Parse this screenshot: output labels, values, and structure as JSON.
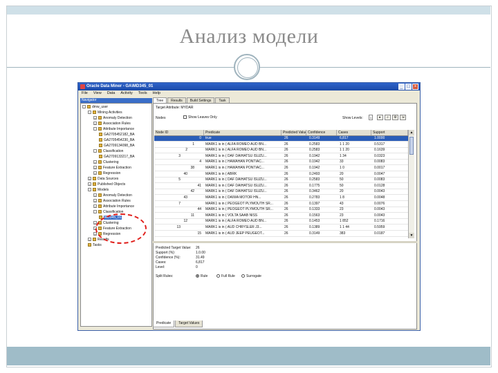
{
  "slide": {
    "title": "Анализ модели"
  },
  "window": {
    "title": "Oracle Data Miner - GA\\MD345_01",
    "min": "_",
    "max": "□",
    "close": "×"
  },
  "menu": [
    "File",
    "View",
    "Data",
    "Activity",
    "Tools",
    "Help"
  ],
  "navigator": {
    "header": "Navigator",
    "items": [
      {
        "label": "dmw_user",
        "indent": 0,
        "toggle": "-"
      },
      {
        "label": "Mining Activities",
        "indent": 1,
        "toggle": "-"
      },
      {
        "label": "Anomaly Detection",
        "indent": 2,
        "toggle": "+"
      },
      {
        "label": "Association Rules",
        "indent": 2,
        "toggle": "+"
      },
      {
        "label": "Attribute Importance",
        "indent": 2,
        "toggle": "-"
      },
      {
        "label": "GA2705452182_BA",
        "indent": 3,
        "toggle": ""
      },
      {
        "label": "GA2705454230_BA",
        "indent": 3,
        "toggle": ""
      },
      {
        "label": "GA2709134098_BA",
        "indent": 3,
        "toggle": ""
      },
      {
        "label": "Classification",
        "indent": 2,
        "toggle": "-"
      },
      {
        "label": "GA2709133217_BA",
        "indent": 3,
        "toggle": ""
      },
      {
        "label": "Clustering",
        "indent": 2,
        "toggle": "+"
      },
      {
        "label": "Feature Extraction",
        "indent": 2,
        "toggle": "+"
      },
      {
        "label": "Regression",
        "indent": 2,
        "toggle": "+"
      },
      {
        "label": "Data Sources",
        "indent": 1,
        "toggle": "+"
      },
      {
        "label": "Published Objects",
        "indent": 1,
        "toggle": "+"
      },
      {
        "label": "Models",
        "indent": 1,
        "toggle": "-"
      },
      {
        "label": "Anomaly Detection",
        "indent": 2,
        "toggle": "+"
      },
      {
        "label": "Association Rules",
        "indent": 2,
        "toggle": "+"
      },
      {
        "label": "Attribute Importance",
        "indent": 2,
        "toggle": "+"
      },
      {
        "label": "Classification",
        "indent": 2,
        "toggle": "-"
      },
      {
        "label": "MD345_01",
        "indent": 3,
        "toggle": "",
        "selected": true
      },
      {
        "label": "Clustering",
        "indent": 2,
        "toggle": "+"
      },
      {
        "label": "Feature Extraction",
        "indent": 2,
        "toggle": "+"
      },
      {
        "label": "Regression",
        "indent": 2,
        "toggle": "+"
      },
      {
        "label": "Results",
        "indent": 1,
        "toggle": "+"
      },
      {
        "label": "Tasks",
        "indent": 1,
        "toggle": ""
      }
    ]
  },
  "tabs": [
    "Tree",
    "Results",
    "Build Settings",
    "Task"
  ],
  "target": {
    "label": "Target Attribute:",
    "value": "MYDAR"
  },
  "nodes_label": "Nodes",
  "show_leaves": "Show Leaves Only",
  "show_levels_label": "Show Levels:",
  "show_levels_value": "1",
  "grid": {
    "columns": [
      "Node ID",
      "Predicate",
      "Predicted Value",
      "Confidence",
      "Cases",
      "Support"
    ],
    "rows": [
      [
        "0",
        "true",
        "26",
        "0.3149",
        "6,817",
        "1.0000"
      ],
      [
        "1",
        "MARK1 is in ( ALFA ROMEO AUD BN...",
        "26",
        "0.2583",
        "1 1 20",
        "0.5317"
      ],
      [
        "2",
        "MARK1 is in ( ALFA ROMEO AUD BN...",
        "26",
        "0.2583",
        "1 1 20",
        "0.1639"
      ],
      [
        "3",
        "MARK1 is in ( DAF DAIHATSU ISUZU...",
        "26",
        "0.1942",
        "1 34",
        "0.0323"
      ],
      [
        "4",
        "MARK1 is in ( HAWAHAN PONTIAC...",
        "26",
        "0.1942",
        "33",
        "0.0083"
      ],
      [
        "38",
        "MARK1 is in ( HAWAHAN PONTIAC...",
        "26",
        "0.1942",
        "1 0",
        "0.0017"
      ],
      [
        "40",
        "MARK1 is in ( ABRK",
        "26",
        "0.2493",
        "20",
        "0.0047"
      ],
      [
        "5",
        "MARK1 is in ( DAF DAIHATSU ISUZU...",
        "26",
        "0.2583",
        "50",
        "0.0083"
      ],
      [
        "41",
        "MARK1 is in ( DAF DAIHATSU ISUZU...",
        "26",
        "0.1775",
        "50",
        "0.0128"
      ],
      [
        "42",
        "MARK1 is in ( DAF DAIHATSU ISUZU...",
        "26",
        "0.3462",
        "20",
        "0.0043"
      ],
      [
        "43",
        "MARK1 is in ( DAIWA MOTOR HN...",
        "26",
        "0.2783",
        "1 8",
        "0.0048"
      ],
      [
        "7",
        "MARK1 is in ( PEOGEOT PLYMOUTH SR...",
        "26",
        "0.1397",
        "43",
        "0.0076"
      ],
      [
        "44",
        "MARK1 is in ( PEOGEOT PLYMOUTH SR...",
        "26",
        "0.1333",
        "23",
        "0.0043"
      ],
      [
        "11",
        "MARK1 is in ( VOLTA SAAB NISS",
        "26",
        "0.1563",
        "23",
        "0.0043"
      ],
      [
        "12",
        "MARK1 is in ( ALFA ROMEO AUD BN...",
        "26",
        "0.1453",
        "1 852",
        "0.1716"
      ],
      [
        "13",
        "MARK1 is in ( AUD CHRYSLER J3...",
        "26",
        "0.1389",
        "1 1 44",
        "0.5959"
      ],
      [
        "15",
        "MARK1 is in ( AUD JEEP PEUGEOT...",
        "26",
        "0.3149",
        "383",
        "0.0187"
      ]
    ]
  },
  "detail": {
    "rows": [
      {
        "label": "Predicted Target Value:",
        "value": "26"
      },
      {
        "label": "Support (%):",
        "value": "1.0.00"
      },
      {
        "label": "Confidence (%):",
        "value": "31.49"
      },
      {
        "label": "Cases:",
        "value": "6,817"
      },
      {
        "label": "Level:",
        "value": "0"
      }
    ],
    "split_label": "Split Rules:",
    "split_options": [
      {
        "label": "Rule",
        "selected": true
      },
      {
        "label": "Full Rule",
        "selected": false
      },
      {
        "label": "Surrogate",
        "selected": false
      }
    ]
  },
  "bottom_tabs": [
    "Predicate",
    "Target Values"
  ],
  "colors": {
    "accent": "#2a5db8",
    "annotation": "#e0201c",
    "slide_band": "#9fbcc8"
  }
}
